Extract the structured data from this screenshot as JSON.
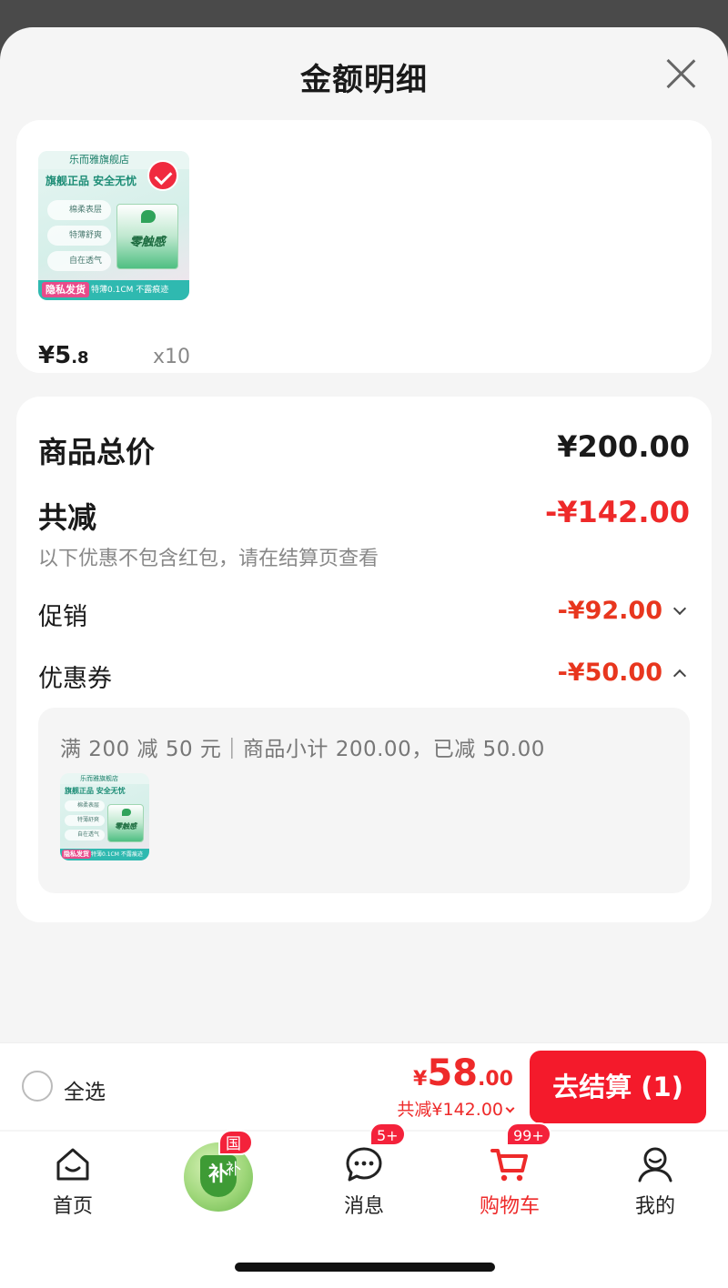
{
  "sheet": {
    "title": "金额明细"
  },
  "product": {
    "thumb": {
      "store": "乐而雅旗舰店",
      "tagline": "旗舰正品 安全无忧",
      "features": [
        "棉柔表层",
        "特薄舒爽",
        "自在透气"
      ],
      "pack_name": "零触感",
      "private_tag": "隐私发货",
      "bottom_text": "特薄0.1CM 不露痕迹"
    },
    "price_int": "¥5",
    "price_dec": ".8",
    "quantity": "x10"
  },
  "detail": {
    "total_label": "商品总价",
    "total_value": "¥200.00",
    "reduce_label": "共减",
    "reduce_value": "-¥142.00",
    "note": "以下优惠不包含红包，请在结算页查看",
    "promo_label": "促销",
    "promo_value": "-¥92.00",
    "coupon_label": "优惠券",
    "coupon_value": "-¥50.00",
    "coupon_desc": "满 200 减 50 元｜商品小计 200.00，已减 50.00"
  },
  "checkout": {
    "select_all": "全选",
    "currency": "¥",
    "price_int": "58",
    "price_dec": ".00",
    "reduce_text": "共减¥142.00",
    "button": "去结算 (1)"
  },
  "tabbar": {
    "home": "首页",
    "subsidy_badge": "国补",
    "subsidy_char": "补",
    "messages": "消息",
    "messages_badge": "5+",
    "cart": "购物车",
    "cart_badge": "99+",
    "mine": "我的"
  },
  "colors": {
    "accent": "#f41a2b",
    "discount": "#ee2a2a"
  }
}
